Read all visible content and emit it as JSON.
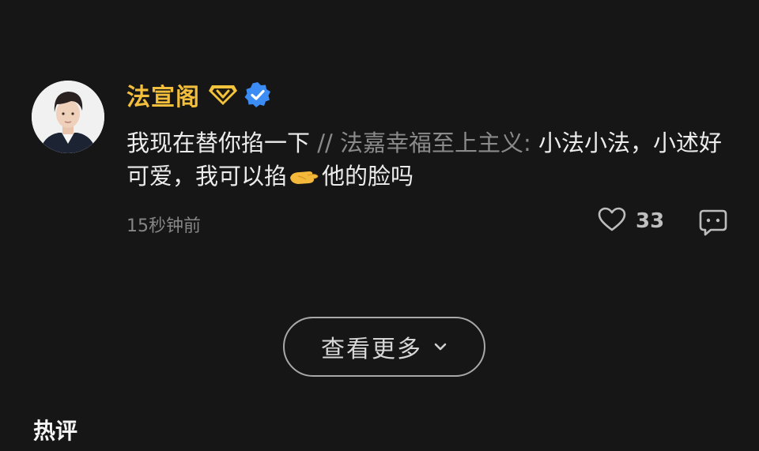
{
  "comment": {
    "username": "法宣阁",
    "text_before": "我现在替你掐一下",
    "separator": " // ",
    "quoted_user": "法嘉幸福至上主义:",
    "quoted_part1": " 小法小法，小述好可爱，我可以掐",
    "quoted_part2": "他的脸吗",
    "timestamp": "15秒钟前",
    "like_count": "33",
    "icons": {
      "avatar": "avatar",
      "vip": "vip-diamond-icon",
      "verified": "verified-badge-icon",
      "emoji": "pinching-hand-emoji-icon",
      "like": "heart-icon",
      "reply": "comment-bubble-icon"
    }
  },
  "show_more": {
    "label": "查看更多",
    "icon": "chevron-down-icon"
  },
  "section": {
    "title": "热评"
  },
  "colors": {
    "background": "#161616",
    "username": "#f3be3c",
    "verified": "#3b8cf5",
    "quoted": "#8a8a8a"
  }
}
